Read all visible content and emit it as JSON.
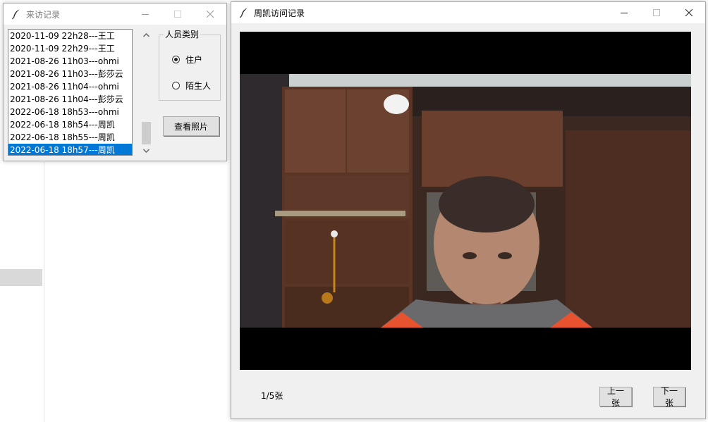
{
  "visitor_window": {
    "title": "来访记录",
    "records": [
      "2020-11-09 22h28---王工",
      "2020-11-09 22h29---王工",
      "2021-08-26 11h03---ohmi",
      "2021-08-26 11h03---彭莎云",
      "2021-08-26 11h04---ohmi",
      "2021-08-26 11h04---彭莎云",
      "2022-06-18 18h53---ohmi",
      "2022-06-18 18h54---周凯",
      "2022-06-18 18h55---周凯",
      "2022-06-18 18h57---周凯"
    ],
    "selected_index": 9,
    "group_label": "人员类别",
    "radio_options": [
      "住户",
      "陌生人"
    ],
    "radio_selected": 0,
    "view_button": "查看照片"
  },
  "photo_window": {
    "title": "周凯访问记录",
    "page_counter": "1/5张",
    "prev_button": "上一张",
    "next_button": "下一张"
  },
  "colors": {
    "selection": "#0078d7",
    "window_bg": "#f0f0f0",
    "titlebar_bg": "#ffffff"
  },
  "icons": [
    "feather-icon",
    "minimize-icon",
    "maximize-icon",
    "close-icon",
    "scroll-up-arrow-icon",
    "scroll-down-arrow-icon"
  ]
}
